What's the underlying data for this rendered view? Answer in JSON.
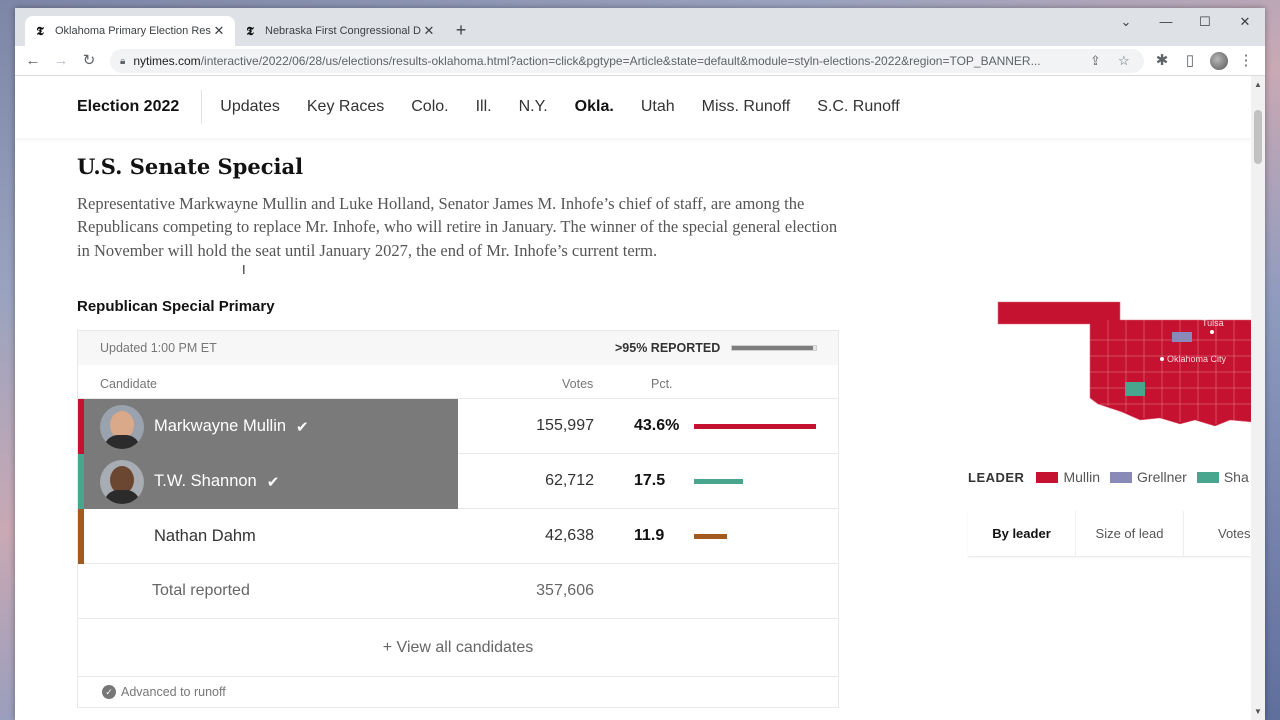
{
  "browser": {
    "tabs": [
      {
        "title": "Oklahoma Primary Election Resu",
        "favicon": "nyt-icon",
        "active": true
      },
      {
        "title": "Nebraska First Congressional Di",
        "favicon": "nyt-icon",
        "active": false
      }
    ],
    "url_host": "nytimes.com",
    "url_path": "/interactive/2022/06/28/us/elections/results-oklahoma.html?action=click&pgtype=Article&state=default&module=styln-elections-2022&region=TOP_BANNER..."
  },
  "nav": {
    "brand": "Election 2022",
    "items": [
      "Updates",
      "Key Races",
      "Colo.",
      "Ill.",
      "N.Y.",
      "Okla.",
      "Utah",
      "Miss. Runoff",
      "S.C. Runoff"
    ],
    "current": "Okla."
  },
  "section": {
    "title": "U.S. Senate Special",
    "description": "Representative Markwayne Mullin and Luke Holland, Senator James M. Inhofe’s chief of staff, are among the Republicans competing to replace Mr. Inhofe, who will retire in January. The winner of the special general election in November will hold the seat until January 2027, the end of Mr. Inhofe’s current term.",
    "race_title": "Republican Special Primary"
  },
  "results": {
    "updated": "Updated 1:00 PM ET",
    "reported_label": ">95% REPORTED",
    "reported_fraction": 0.96,
    "col_candidate": "Candidate",
    "col_votes": "Votes",
    "col_pct": "Pct.",
    "candidates": [
      {
        "name": "Markwayne Mullin",
        "votes": "155,997",
        "pct": "43.6%",
        "pct_value": 43.6,
        "color": "#c41230",
        "advanced": true
      },
      {
        "name": "T.W. Shannon",
        "votes": "62,712",
        "pct": "17.5",
        "pct_value": 17.5,
        "color": "#48a58e",
        "advanced": true
      },
      {
        "name": "Nathan Dahm",
        "votes": "42,638",
        "pct": "11.9",
        "pct_value": 11.9,
        "color": "#a35a1e",
        "advanced": false
      }
    ],
    "total_label": "Total reported",
    "total_votes": "357,606",
    "view_all": "+ View all candidates",
    "runoff_note": "Advanced to runoff"
  },
  "map": {
    "labels": [
      "Tulsa",
      "Oklahoma City"
    ],
    "legend_title": "LEADER",
    "legend": [
      {
        "name": "Mullin",
        "color": "#c41230"
      },
      {
        "name": "Grellner",
        "color": "#8a8ab8"
      },
      {
        "name": "Sha",
        "color": "#48a58e"
      }
    ],
    "tabs": [
      "By leader",
      "Size of lead",
      "Votes l"
    ],
    "active_tab": "By leader"
  }
}
